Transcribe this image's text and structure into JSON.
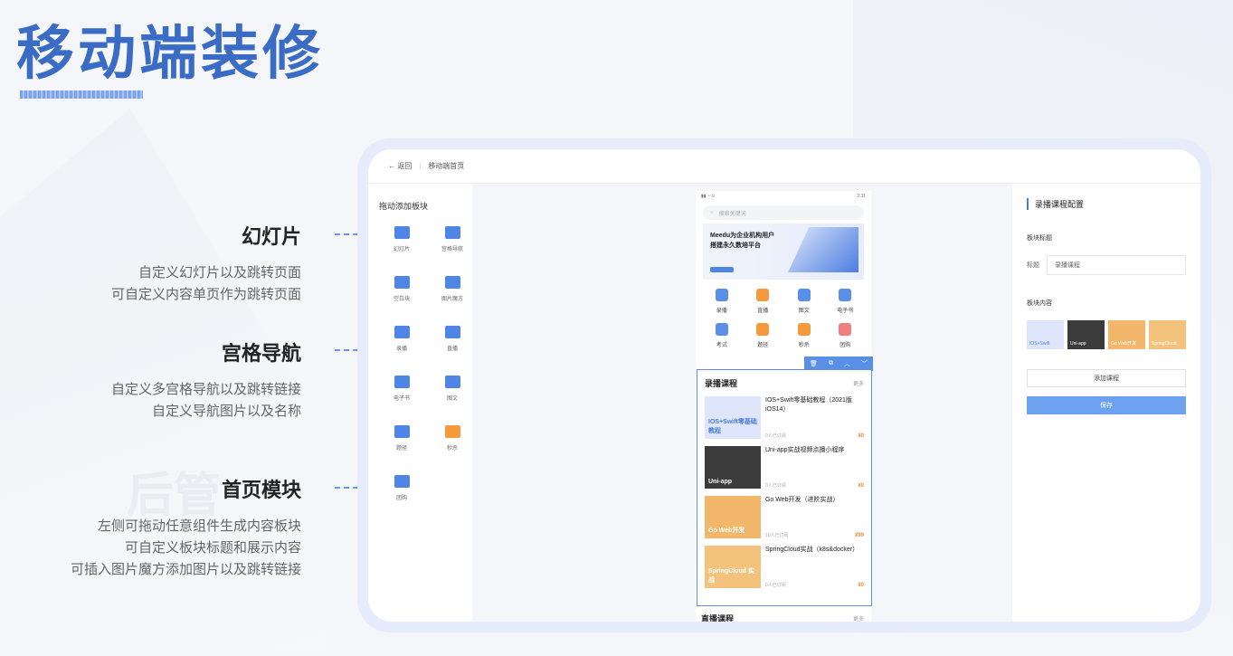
{
  "title": "移动端装修",
  "features": [
    {
      "heading": "幻灯片",
      "lines": [
        "自定义幻灯片以及跳转页面",
        "可自定义内容单页作为跳转页面"
      ]
    },
    {
      "heading": "宫格导航",
      "lines": [
        "自定义多宫格导航以及跳转链接",
        "自定义导航图片以及名称"
      ]
    },
    {
      "heading": "首页模块",
      "lines": [
        "左侧可拖动任意组件生成内容板块",
        "可自定义板块标题和展示内容",
        "可插入图片魔方添加图片以及跳转链接"
      ]
    }
  ],
  "editor": {
    "back": "返回",
    "page_title": "移动端首页",
    "left_title": "拖动添加板块",
    "components": [
      {
        "label": "幻灯片",
        "icon": "slideshow-icon"
      },
      {
        "label": "宫格导航",
        "icon": "grid-nav-icon"
      },
      {
        "label": "空白块",
        "icon": "blank-block-icon"
      },
      {
        "label": "图片魔方",
        "icon": "image-cube-icon"
      },
      {
        "label": "录播",
        "icon": "recorded-icon"
      },
      {
        "label": "直播",
        "icon": "live-icon"
      },
      {
        "label": "电子书",
        "icon": "ebook-icon"
      },
      {
        "label": "图文",
        "icon": "article-icon"
      },
      {
        "label": "题径",
        "icon": "path-icon"
      },
      {
        "label": "秒杀",
        "icon": "flash-sale-icon"
      },
      {
        "label": "团购",
        "icon": "group-buy-icon"
      }
    ],
    "phone": {
      "time": "2:31",
      "search_placeholder": "搜索关键词",
      "banner_line1": "Meedu为企业机构用户",
      "banner_line2": "搭建永久数培平台",
      "nav": [
        {
          "label": "录播",
          "color": "#5a8fe8"
        },
        {
          "label": "直播",
          "color": "#f39a3c"
        },
        {
          "label": "图文",
          "color": "#5a8fe8"
        },
        {
          "label": "电子书",
          "color": "#5a8fe8"
        },
        {
          "label": "考试",
          "color": "#5a8fe8"
        },
        {
          "label": "题径",
          "color": "#f39a3c"
        },
        {
          "label": "秒杀",
          "color": "#f39a3c"
        },
        {
          "label": "团购",
          "color": "#f08080"
        }
      ],
      "module_title": "录播课程",
      "more": "更多",
      "courses": [
        {
          "title": "IOS+Swift零基础教程（2021版iOS14）",
          "subs": "0人已订阅",
          "price": "¥0",
          "thumb": "IOS+Swift零基础教程",
          "bg": "#dfe6fb"
        },
        {
          "title": "Uni-app实战视频点播小程序",
          "subs": "0人已订阅",
          "price": "¥0",
          "thumb": "Uni-app",
          "bg": "#3b3b3b"
        },
        {
          "title": "Go Web开发（进阶实战）",
          "subs": "10人已订阅",
          "price": "¥99",
          "thumb": "Go Web开发",
          "bg": "#f3b76b"
        },
        {
          "title": "SpringCloud实战（k8s&docker）",
          "subs": "0人已订阅",
          "price": "¥0",
          "thumb": "SpringCloud 实战",
          "bg": "#f3c27c"
        }
      ],
      "next_module": "直播课程",
      "next_more": "更多"
    },
    "config": {
      "title": "录播课程配置",
      "block_title_label": "板块标题",
      "field_label": "标题",
      "field_value": "录播课程",
      "content_label": "板块内容",
      "thumbs": [
        {
          "text": "IOS+Swift",
          "bg": "#dfe6fb"
        },
        {
          "text": "Uni-app",
          "bg": "#3b3b3b"
        },
        {
          "text": "Go Web开发",
          "bg": "#f3b76b"
        },
        {
          "text": "SpringCloud",
          "bg": "#f3c27c"
        }
      ],
      "add_button": "添加课程",
      "save_button": "保存"
    }
  },
  "watermark": "后管"
}
